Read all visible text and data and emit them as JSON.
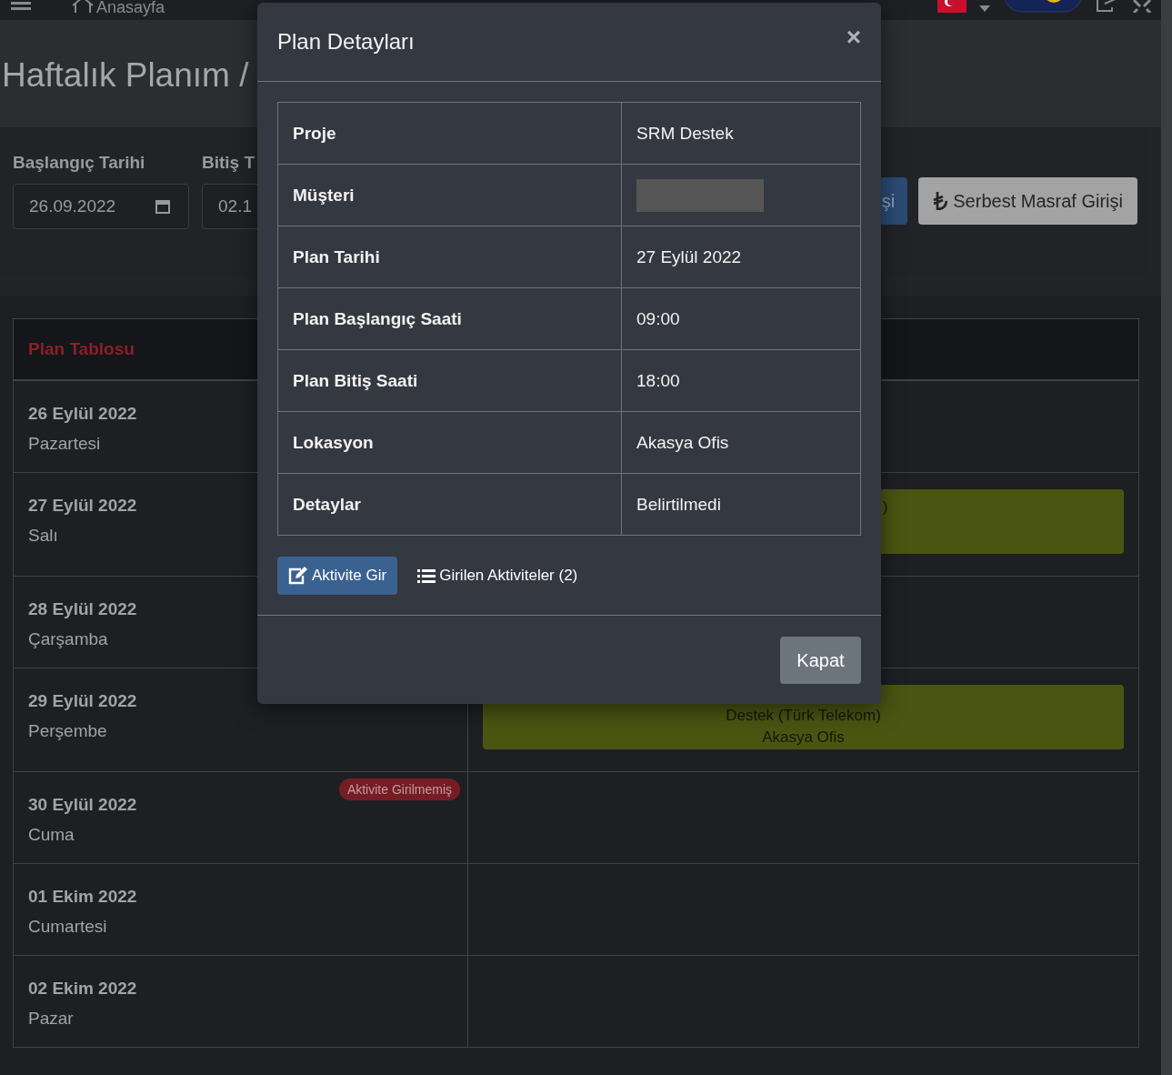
{
  "topbar": {
    "home_label": "Anasayfa"
  },
  "page_title": "Haftalık Planım /",
  "filters": {
    "start_label": "Başlangıç Tarihi",
    "start_value": "26.09.2022",
    "end_label": "Bitiş T",
    "end_value": "02.1",
    "buttons": [
      {
        "label": "şi",
        "kind": "primary"
      },
      {
        "label": "Serbest Masraf Girişi",
        "kind": "secondary"
      }
    ]
  },
  "plan_table": {
    "title": "Plan Tablosu",
    "days": [
      {
        "date": "26 Eylül 2022",
        "weekday": "Pazartesi"
      },
      {
        "date": "27 Eylül 2022",
        "weekday": "Salı",
        "events": [
          {
            "kind": "clipped",
            "lines": [
              ")"
            ]
          }
        ]
      },
      {
        "date": "28 Eylül 2022",
        "weekday": "Çarşamba"
      },
      {
        "date": "29 Eylül 2022",
        "weekday": "Perşembe",
        "events": [
          {
            "kind": "full",
            "lines": [
              "Destek (Türk Telekom)",
              "Akasya Ofis"
            ]
          }
        ]
      },
      {
        "date": "30 Eylül 2022",
        "weekday": "Cuma",
        "badge": "Aktivite Girilmemiş"
      },
      {
        "date": "01 Ekim 2022",
        "weekday": "Cumartesi"
      },
      {
        "date": "02 Ekim 2022",
        "weekday": "Pazar"
      }
    ]
  },
  "modal": {
    "title": "Plan Detayları",
    "close": "×",
    "rows": [
      {
        "label": "Proje",
        "value": "SRM Destek"
      },
      {
        "label": "Müşteri",
        "redacted": true
      },
      {
        "label": "Plan Tarihi",
        "value": "27 Eylül 2022"
      },
      {
        "label": "Plan Başlangıç Saati",
        "value": "09:00"
      },
      {
        "label": "Plan Bitiş Saati",
        "value": "18:00"
      },
      {
        "label": "Lokasyon",
        "value": "Akasya Ofis"
      },
      {
        "label": "Detaylar",
        "value": "Belirtilmedi"
      }
    ],
    "enter_button": "Aktivite Gir",
    "activities_link": "Girilen Aktiviteler (2)",
    "close_button": "Kapat"
  }
}
